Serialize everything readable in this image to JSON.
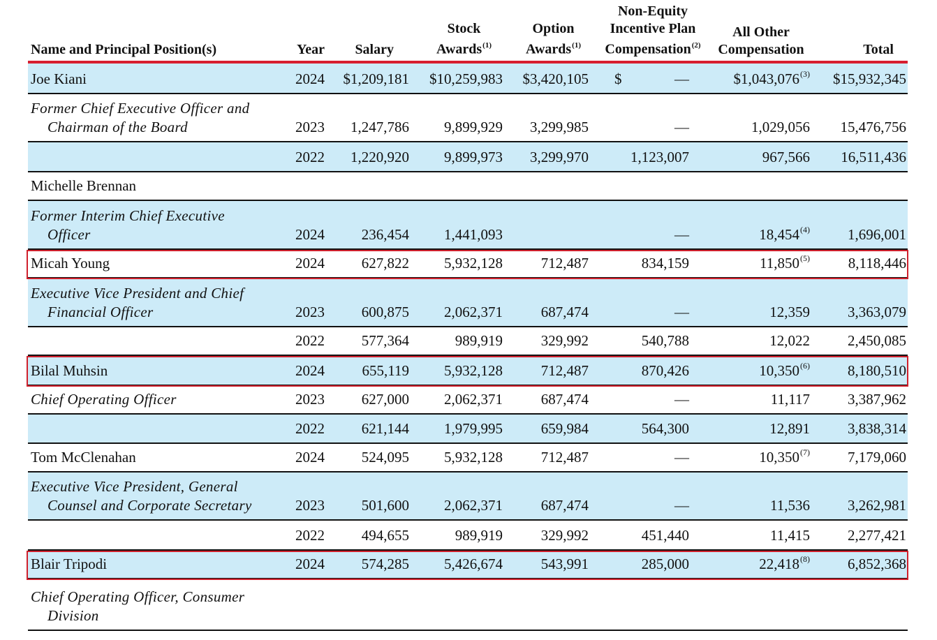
{
  "headers": {
    "name": "Name and Principal Position(s)",
    "year": "Year",
    "salary": "Salary",
    "stock_l1": "Stock",
    "stock_l2": "Awards",
    "stock_fn": "(1)",
    "option_l1": "Option",
    "option_l2": "Awards",
    "option_fn": "(1)",
    "nonequity_l1": "Non-Equity",
    "nonequity_l2": "Incentive Plan",
    "nonequity_l3": "Compensation",
    "nonequity_fn": "(2)",
    "other_l1": "All Other",
    "other_l2": "Compensation",
    "total": "Total"
  },
  "rows": [
    {
      "name": "Joe Kiani",
      "year": "2024",
      "salary": "$1,209,181",
      "stock": "$10,259,983",
      "option": "$3,420,105",
      "dollar": "$",
      "nonequity": "—",
      "other": "$1,043,076",
      "other_fn": "(3)",
      "total": "$15,932,345"
    },
    {
      "pos1": "Former Chief Executive Officer and",
      "pos2": "Chairman of the Board",
      "year": "2023",
      "salary": "1,247,786",
      "stock": "9,899,929",
      "option": "3,299,985",
      "nonequity": "—",
      "other": "1,029,056",
      "total": "15,476,756"
    },
    {
      "year": "2022",
      "salary": "1,220,920",
      "stock": "9,899,973",
      "option": "3,299,970",
      "nonequity": "1,123,007",
      "other": "967,566",
      "total": "16,511,436"
    },
    {
      "name": "Michelle Brennan"
    },
    {
      "pos1": "Former Interim Chief Executive",
      "pos2": "Officer",
      "year": "2024",
      "salary": "236,454",
      "stock": "1,441,093",
      "nonequity": "—",
      "other": "18,454",
      "other_fn": "(4)",
      "total": "1,696,001"
    },
    {
      "name": "Micah Young",
      "year": "2024",
      "salary": "627,822",
      "stock": "5,932,128",
      "option": "712,487",
      "nonequity": "834,159",
      "other": "11,850",
      "other_fn": "(5)",
      "total": "8,118,446"
    },
    {
      "pos1": "Executive Vice President and Chief",
      "pos2": "Financial Officer",
      "year": "2023",
      "salary": "600,875",
      "stock": "2,062,371",
      "option": "687,474",
      "nonequity": "—",
      "other": "12,359",
      "total": "3,363,079"
    },
    {
      "year": "2022",
      "salary": "577,364",
      "stock": "989,919",
      "option": "329,992",
      "nonequity": "540,788",
      "other": "12,022",
      "total": "2,450,085"
    },
    {
      "name": "Bilal Muhsin",
      "year": "2024",
      "salary": "655,119",
      "stock": "5,932,128",
      "option": "712,487",
      "nonequity": "870,426",
      "other": "10,350",
      "other_fn": "(6)",
      "total": "8,180,510"
    },
    {
      "pos1": "Chief Operating Officer",
      "year": "2023",
      "salary": "627,000",
      "stock": "2,062,371",
      "option": "687,474",
      "nonequity": "—",
      "other": "11,117",
      "total": "3,387,962"
    },
    {
      "year": "2022",
      "salary": "621,144",
      "stock": "1,979,995",
      "option": "659,984",
      "nonequity": "564,300",
      "other": "12,891",
      "total": "3,838,314"
    },
    {
      "name": "Tom McClenahan",
      "year": "2024",
      "salary": "524,095",
      "stock": "5,932,128",
      "option": "712,487",
      "nonequity": "—",
      "other": "10,350",
      "other_fn": "(7)",
      "total": "7,179,060"
    },
    {
      "pos1": "Executive Vice President, General",
      "pos2": "Counsel and Corporate Secretary",
      "year": "2023",
      "salary": "501,600",
      "stock": "2,062,371",
      "option": "687,474",
      "nonequity": "—",
      "other": "11,536",
      "total": "3,262,981"
    },
    {
      "year": "2022",
      "salary": "494,655",
      "stock": "989,919",
      "option": "329,992",
      "nonequity": "451,440",
      "other": "11,415",
      "total": "2,277,421"
    },
    {
      "name": "Blair Tripodi",
      "year": "2024",
      "salary": "574,285",
      "stock": "5,426,674",
      "option": "543,991",
      "nonequity": "285,000",
      "other": "22,418",
      "other_fn": "(8)",
      "total": "6,852,368"
    },
    {
      "pos1": "Chief Operating Officer, Consumer",
      "pos2": "Division"
    }
  ],
  "highlight_color": "#d0202c",
  "shade_color": "#cdebf8",
  "rule_color": "#d71f30"
}
